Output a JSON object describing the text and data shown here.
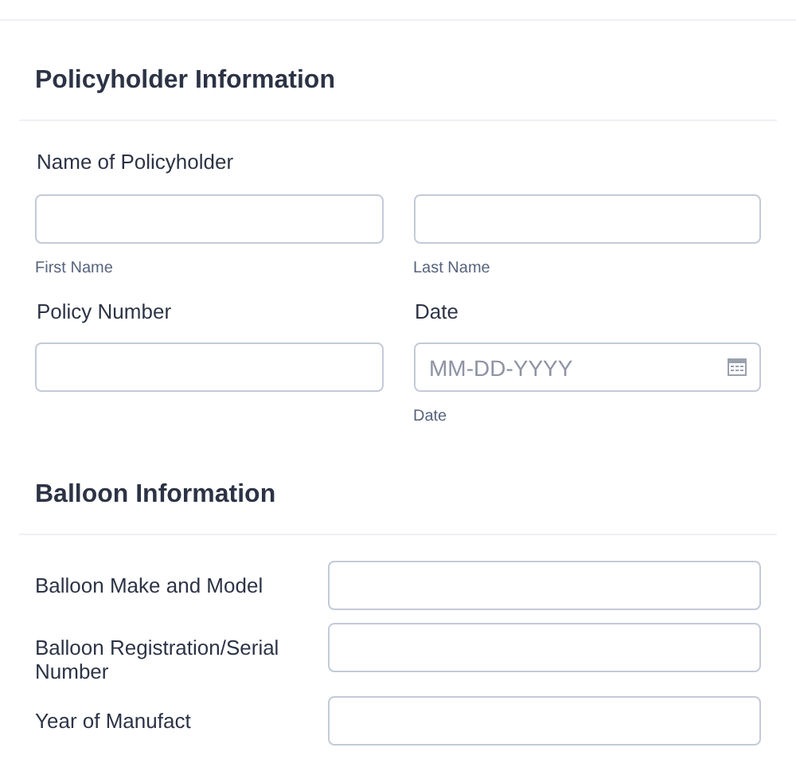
{
  "sections": [
    {
      "title": "Policyholder Information",
      "fields": [
        {
          "label": "Name of Policyholder",
          "kind": "pair",
          "inputs": [
            {
              "kind": "text",
              "sublabel": "First Name"
            },
            {
              "kind": "text",
              "sublabel": "Last Name"
            }
          ]
        },
        {
          "kind": "split",
          "items": [
            {
              "label": "Policy Number",
              "inputs": [
                {
                  "kind": "text"
                }
              ]
            },
            {
              "label": "Date",
              "inputs": [
                {
                  "kind": "date",
                  "placeholder": "MM-DD-YYYY",
                  "sublabel": "Date"
                }
              ]
            }
          ]
        }
      ]
    },
    {
      "title": "Balloon Information",
      "fields": [
        {
          "label": "Balloon Make and Model",
          "kind": "side"
        },
        {
          "label": "Balloon Registration/Serial Number",
          "kind": "side"
        },
        {
          "label": "Year of Manufact",
          "kind": "side"
        }
      ]
    }
  ]
}
